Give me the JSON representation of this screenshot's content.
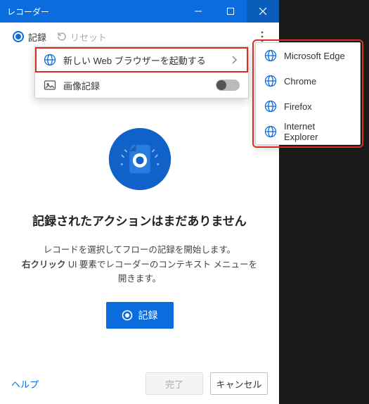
{
  "window": {
    "title": "レコーダー"
  },
  "toolbar": {
    "record_label": "記録",
    "reset_label": "リセット"
  },
  "dropdown": {
    "launch_browser_label": "新しい Web ブラウザーを起動する",
    "image_record_label": "画像記録"
  },
  "browsers": [
    {
      "name": "Microsoft Edge"
    },
    {
      "name": "Chrome"
    },
    {
      "name": "Firefox"
    },
    {
      "name": "Internet Explorer"
    }
  ],
  "main": {
    "heading": "記録されたアクションはまだありません",
    "desc_line1": "レコードを選択してフローの記録を開始します。",
    "desc_line2_bold": "右クリック",
    "desc_line2_rest": " UI 要素でレコーダーのコンテキスト メニューを",
    "desc_line3": "開きます。",
    "record_button": "記録"
  },
  "footer": {
    "help": "ヘルプ",
    "done": "完了",
    "cancel": "キャンセル"
  }
}
